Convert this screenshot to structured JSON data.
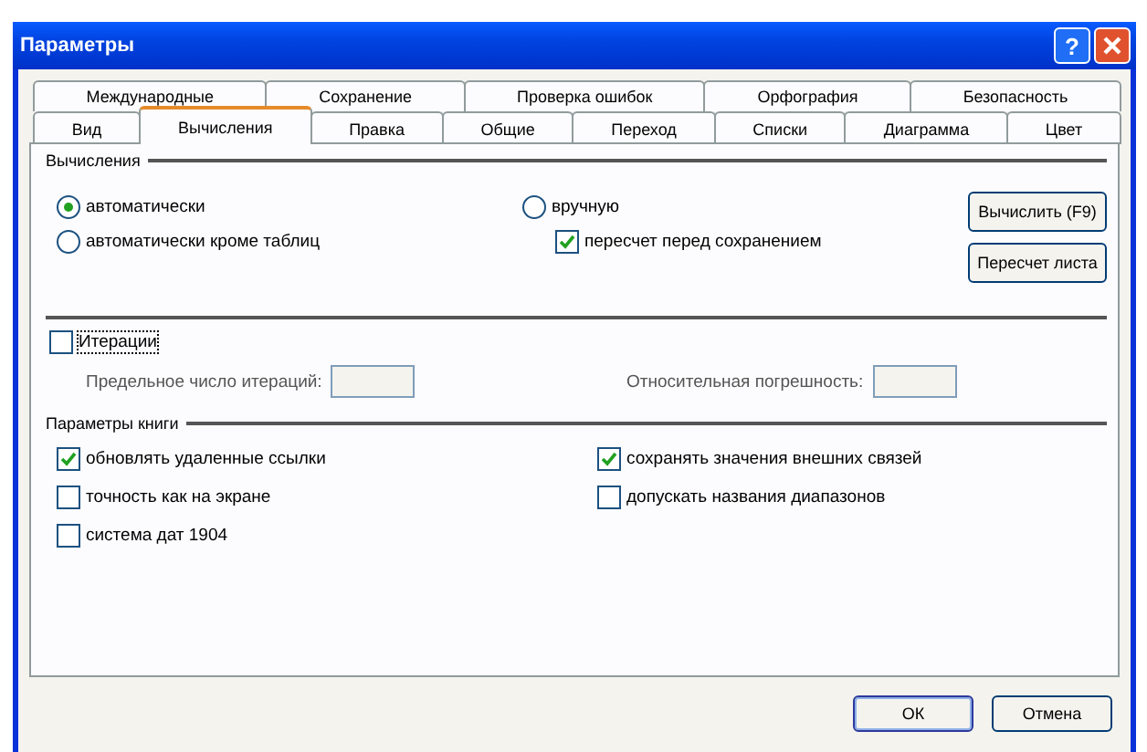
{
  "window": {
    "title": "Параметры",
    "help_button": "?"
  },
  "tab_rows": [
    [
      {
        "label": "Международные",
        "selected": false
      },
      {
        "label": "Сохранение",
        "selected": false
      },
      {
        "label": "Проверка ошибок",
        "selected": false
      },
      {
        "label": "Орфография",
        "selected": false
      },
      {
        "label": "Безопасность",
        "selected": false
      }
    ],
    [
      {
        "label": "Вид",
        "selected": false
      },
      {
        "label": "Вычисления",
        "selected": true
      },
      {
        "label": "Правка",
        "selected": false
      },
      {
        "label": "Общие",
        "selected": false
      },
      {
        "label": "Переход",
        "selected": false
      },
      {
        "label": "Списки",
        "selected": false
      },
      {
        "label": "Диаграмма",
        "selected": false
      },
      {
        "label": "Цвет",
        "selected": false
      }
    ]
  ],
  "calculation": {
    "title": "Вычисления",
    "modes": [
      {
        "label": "автоматически",
        "selected": true
      },
      {
        "label": "автоматически кроме таблиц",
        "selected": false
      },
      {
        "label": "вручную",
        "selected": false
      }
    ],
    "recalc_before_save": {
      "label": "пересчет перед сохранением",
      "checked": true
    },
    "buttons": [
      "Вычислить (F9)",
      "Пересчет листа"
    ]
  },
  "iteration": {
    "label": "Итерации",
    "checked": false,
    "fields": [
      {
        "label": "Предельное число итераций:"
      },
      {
        "label": "Относительная погрешность:"
      }
    ]
  },
  "workbook": {
    "title": "Параметры книги",
    "options": [
      {
        "label": "обновлять удаленные ссылки",
        "checked": true
      },
      {
        "label": "сохранять значения внешних связей",
        "checked": true
      },
      {
        "label": "точность как на экране",
        "checked": false
      },
      {
        "label": "допускать названия диапазонов",
        "checked": false
      },
      {
        "label": "система дат 1904",
        "checked": false
      }
    ]
  },
  "buttons": [
    {
      "label": "ОК",
      "kind": "default"
    },
    {
      "label": "Отмена",
      "kind": "normal"
    }
  ]
}
